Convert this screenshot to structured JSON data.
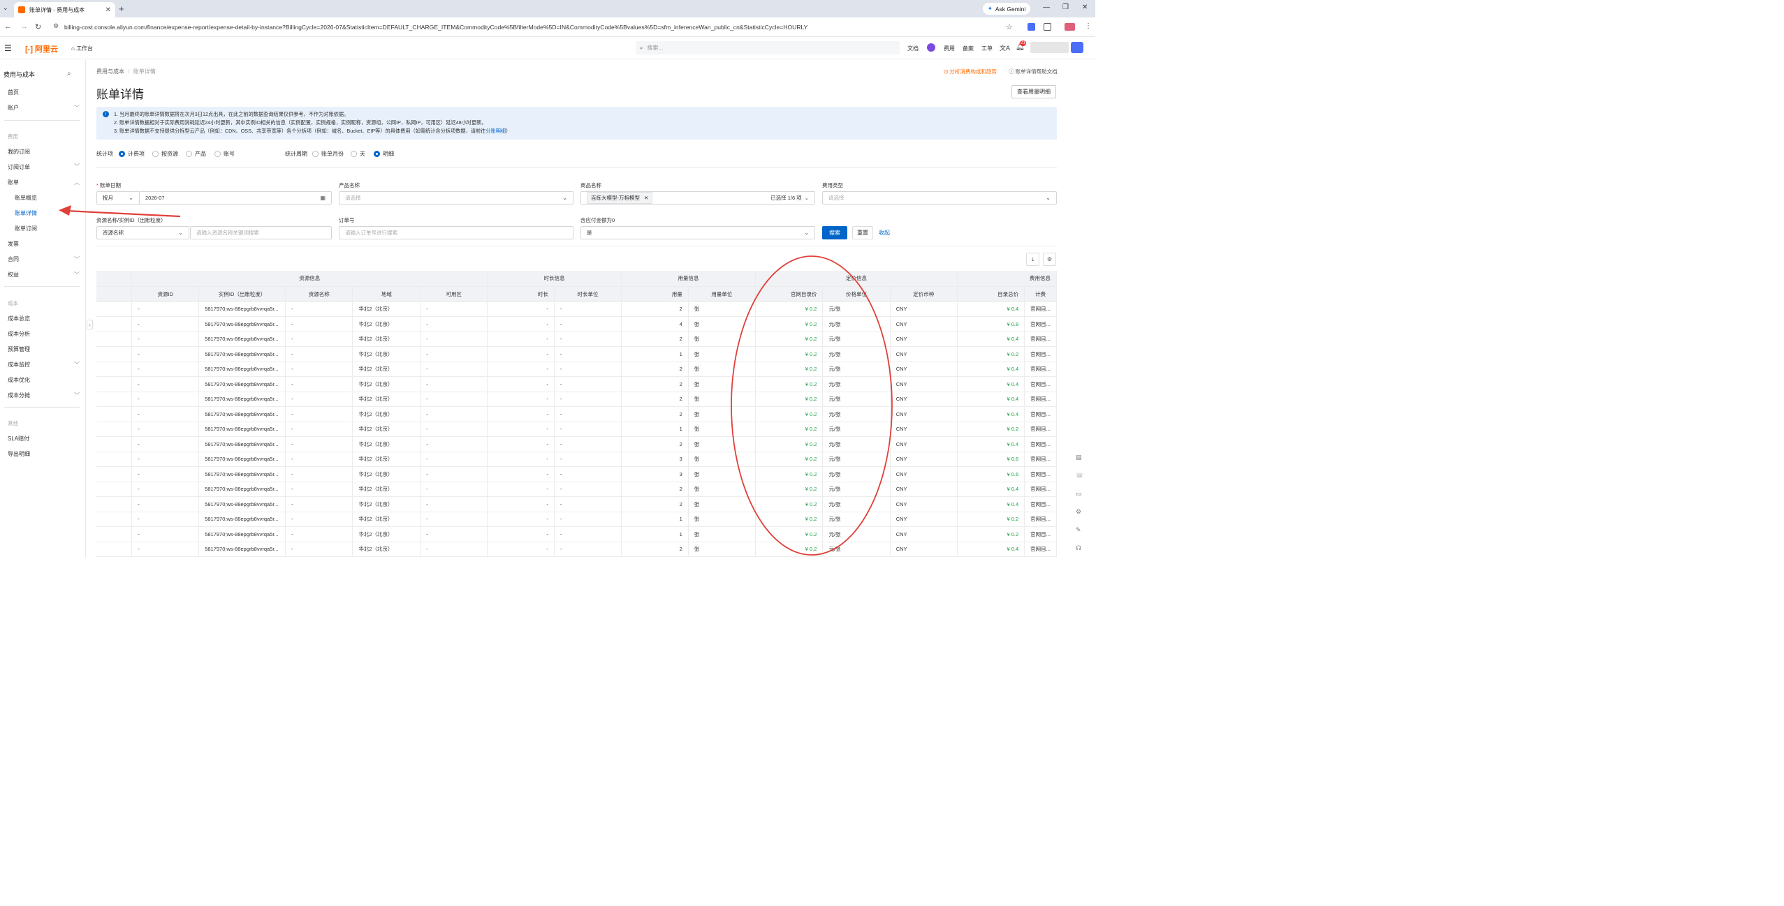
{
  "browser": {
    "tab_title": "账单详情 - 费用与成本",
    "url": "billing-cost.console.aliyun.com/finance/expense-report/expense-detail-by-instance?BillingCycle=2026-07&StatisticItem=DEFAULT_CHARGE_ITEM&CommodityCode%5BfilterMode%5D=IN&CommodityCode%5Bvalues%5D=sfm_inferenceWan_public_cn&StatisticCycle=HOURLY",
    "gemini_label": "Ask Gemini"
  },
  "header": {
    "logo": "阿里云",
    "workbench": "工作台",
    "search_placeholder": "搜索...",
    "links": [
      "文档",
      "费用",
      "备案",
      "工单"
    ],
    "notif_count": "21"
  },
  "sidebar": {
    "title": "费用与成本",
    "items": [
      {
        "label": "首页"
      },
      {
        "label": "账户"
      },
      {
        "label": "费用"
      },
      {
        "label": "我的订阅"
      },
      {
        "label": "订阅订单"
      },
      {
        "label": "账单"
      },
      {
        "label": "账单概览"
      },
      {
        "label": "账单详情"
      },
      {
        "label": "账单订阅"
      },
      {
        "label": "发票"
      },
      {
        "label": "合同"
      },
      {
        "label": "权益"
      },
      {
        "label": "成本"
      },
      {
        "label": "成本总览"
      },
      {
        "label": "成本分析"
      },
      {
        "label": "预算管理"
      },
      {
        "label": "成本监控"
      },
      {
        "label": "成本优化"
      },
      {
        "label": "成本分摊"
      },
      {
        "label": "其他"
      },
      {
        "label": "SLA赔付"
      },
      {
        "label": "导出明细"
      }
    ]
  },
  "page": {
    "breadcrumb_root": "费用与成本",
    "breadcrumb_current": "账单详情",
    "title": "账单详情",
    "analyze_link": "分析消费构成和趋势",
    "help_link": "账单详情帮助文档",
    "usage_button": "查看用量明细",
    "notice": {
      "line1": "1. 当月最终的账单详情数据将在次月3日12点出具，在此之前的数据查询结果仅供参考，不作为对账依据。",
      "line2": "2. 账单详情数据相对于实际费用消耗延迟24小时更新，其中实例ID相关的信息（实例配置，实例规格，实例昵称，资源组，公网IP，私网IP，可用区）延迟48小时更新。",
      "line3_pre": "3. 账单详情数据不支持提供分拆型云产品（例如：CDN、OSS、共享带宽等）各个分拆项（例如：域名、Bucket、EIP等）的具体费用（如需统计含分拆项数据，请前往",
      "line3_link": "分账明细",
      "line3_post": "）"
    },
    "stat_item_label": "统计项",
    "stat_item_options": [
      "计费项",
      "按资源",
      "产品",
      "账号"
    ],
    "stat_item_selected": "计费项",
    "stat_cycle_label": "统计周期",
    "stat_cycle_options": [
      "账单月份",
      "天",
      "明细"
    ],
    "stat_cycle_selected": "明细"
  },
  "filters": {
    "bill_date_label": "账单日期",
    "bill_date_mode": "按月",
    "bill_date_value": "2026-07",
    "product_label": "产品名称",
    "product_placeholder": "请选择",
    "commodity_label": "商品名称",
    "commodity_tag": "百炼大模型-万相模型",
    "commodity_count": "已选择 1/6 项",
    "fee_type_label": "费用类型",
    "fee_type_placeholder": "请选择",
    "resource_label": "资源名称/实例ID（出账粒度）",
    "resource_mode": "资源名称",
    "resource_placeholder": "请输入资源名称关键词搜索",
    "order_label": "订单号",
    "order_placeholder": "请输入订单号进行搜索",
    "zero_label": "含应付金额为0",
    "zero_value": "是",
    "search_btn": "搜索",
    "reset_btn": "重置",
    "collapse_btn": "收起"
  },
  "table": {
    "groups": [
      "资源信息",
      "时长信息",
      "用量信息",
      "定价信息",
      "费用信息"
    ],
    "columns": [
      "资源ID",
      "实例ID（出账粒度）",
      "资源名称",
      "地域",
      "可用区",
      "时长",
      "时长单位",
      "用量",
      "用量单位",
      "官网目录价",
      "价格单位",
      "定价币种",
      "目录总价",
      "计费"
    ],
    "rows": [
      [
        "-",
        "5817970;ws-88epgrb8vvrqa5r...",
        "-",
        "华北2（北京）",
        "-",
        "-",
        "-",
        "2",
        "张",
        "¥ 0.2",
        "元/张",
        "CNY",
        "¥ 0.4",
        "官网目..."
      ],
      [
        "-",
        "5817970;ws-88epgrb8vvrqa5r...",
        "-",
        "华北2（北京）",
        "-",
        "-",
        "-",
        "4",
        "张",
        "¥ 0.2",
        "元/张",
        "CNY",
        "¥ 0.8",
        "官网目..."
      ],
      [
        "-",
        "5817970;ws-88epgrb8vvrqa5r...",
        "-",
        "华北2（北京）",
        "-",
        "-",
        "-",
        "2",
        "张",
        "¥ 0.2",
        "元/张",
        "CNY",
        "¥ 0.4",
        "官网目..."
      ],
      [
        "-",
        "5817970;ws-88epgrb8vvrqa5r...",
        "-",
        "华北2（北京）",
        "-",
        "-",
        "-",
        "1",
        "张",
        "¥ 0.2",
        "元/张",
        "CNY",
        "¥ 0.2",
        "官网目..."
      ],
      [
        "-",
        "5817970;ws-88epgrb8vvrqa5r...",
        "-",
        "华北2（北京）",
        "-",
        "-",
        "-",
        "2",
        "张",
        "¥ 0.2",
        "元/张",
        "CNY",
        "¥ 0.4",
        "官网目..."
      ],
      [
        "-",
        "5817970;ws-88epgrb8vvrqa5r...",
        "-",
        "华北2（北京）",
        "-",
        "-",
        "-",
        "2",
        "张",
        "¥ 0.2",
        "元/张",
        "CNY",
        "¥ 0.4",
        "官网目..."
      ],
      [
        "-",
        "5817970;ws-88epgrb8vvrqa5r...",
        "-",
        "华北2（北京）",
        "-",
        "-",
        "-",
        "2",
        "张",
        "¥ 0.2",
        "元/张",
        "CNY",
        "¥ 0.4",
        "官网目..."
      ],
      [
        "-",
        "5817970;ws-88epgrb8vvrqa5r...",
        "-",
        "华北2（北京）",
        "-",
        "-",
        "-",
        "2",
        "张",
        "¥ 0.2",
        "元/张",
        "CNY",
        "¥ 0.4",
        "官网目..."
      ],
      [
        "-",
        "5817970;ws-88epgrb8vvrqa5r...",
        "-",
        "华北2（北京）",
        "-",
        "-",
        "-",
        "1",
        "张",
        "¥ 0.2",
        "元/张",
        "CNY",
        "¥ 0.2",
        "官网目..."
      ],
      [
        "-",
        "5817970;ws-88epgrb8vvrqa5r...",
        "-",
        "华北2（北京）",
        "-",
        "-",
        "-",
        "2",
        "张",
        "¥ 0.2",
        "元/张",
        "CNY",
        "¥ 0.4",
        "官网目..."
      ],
      [
        "-",
        "5817970;ws-88epgrb8vvrqa5r...",
        "-",
        "华北2（北京）",
        "-",
        "-",
        "-",
        "3",
        "张",
        "¥ 0.2",
        "元/张",
        "CNY",
        "¥ 0.6",
        "官网目..."
      ],
      [
        "-",
        "5817970;ws-88epgrb8vvrqa5r...",
        "-",
        "华北2（北京）",
        "-",
        "-",
        "-",
        "3",
        "张",
        "¥ 0.2",
        "元/张",
        "CNY",
        "¥ 0.6",
        "官网目..."
      ],
      [
        "-",
        "5817970;ws-88epgrb8vvrqa5r...",
        "-",
        "华北2（北京）",
        "-",
        "-",
        "-",
        "2",
        "张",
        "¥ 0.2",
        "元/张",
        "CNY",
        "¥ 0.4",
        "官网目..."
      ],
      [
        "-",
        "5817970;ws-88epgrb8vvrqa5r...",
        "-",
        "华北2（北京）",
        "-",
        "-",
        "-",
        "2",
        "张",
        "¥ 0.2",
        "元/张",
        "CNY",
        "¥ 0.4",
        "官网目..."
      ],
      [
        "-",
        "5817970;ws-88epgrb8vvrqa5r...",
        "-",
        "华北2（北京）",
        "-",
        "-",
        "-",
        "1",
        "张",
        "¥ 0.2",
        "元/张",
        "CNY",
        "¥ 0.2",
        "官网目..."
      ],
      [
        "-",
        "5817970;ws-88epgrb8vvrqa5r...",
        "-",
        "华北2（北京）",
        "-",
        "-",
        "-",
        "1",
        "张",
        "¥ 0.2",
        "元/张",
        "CNY",
        "¥ 0.2",
        "官网目..."
      ],
      [
        "-",
        "5817970;ws-88epgrb8vvrqa5r...",
        "-",
        "华北2（北京）",
        "-",
        "-",
        "-",
        "2",
        "张",
        "¥ 0.2",
        "元/张",
        "CNY",
        "¥ 0.4",
        "官网目..."
      ]
    ]
  },
  "colors": {
    "brand": "#ff6a00",
    "primary": "#0064c8",
    "price_green": "#1a9e44",
    "annotation_red": "#e0403a"
  }
}
